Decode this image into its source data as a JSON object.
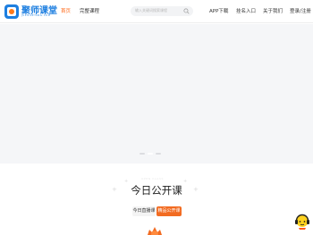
{
  "brand": {
    "name": "聚师课堂",
    "tagline": "JUSHIKETANG.COM"
  },
  "nav": {
    "items": [
      {
        "label": "首页",
        "active": true
      },
      {
        "label": "完整课程",
        "active": false
      }
    ],
    "right": [
      {
        "label": "APP下载"
      },
      {
        "label": "挂名入口"
      },
      {
        "label": "关于我们"
      },
      {
        "label": "登录/注册"
      }
    ]
  },
  "search": {
    "placeholder": "输入关键词搜索课程"
  },
  "banner": {
    "slides": 3,
    "active_slide": 1
  },
  "section": {
    "decoration": "OPEN CLASS",
    "title": "今日公开课",
    "tabs": [
      {
        "label": "今日直播课",
        "selected": false
      },
      {
        "label": "精品公开课",
        "selected": true
      }
    ]
  },
  "colors": {
    "accent": "#f26b21",
    "brand": "#1e7fe0"
  },
  "icons": {
    "search": "search-icon",
    "customer_service": "customer-service-icon"
  }
}
